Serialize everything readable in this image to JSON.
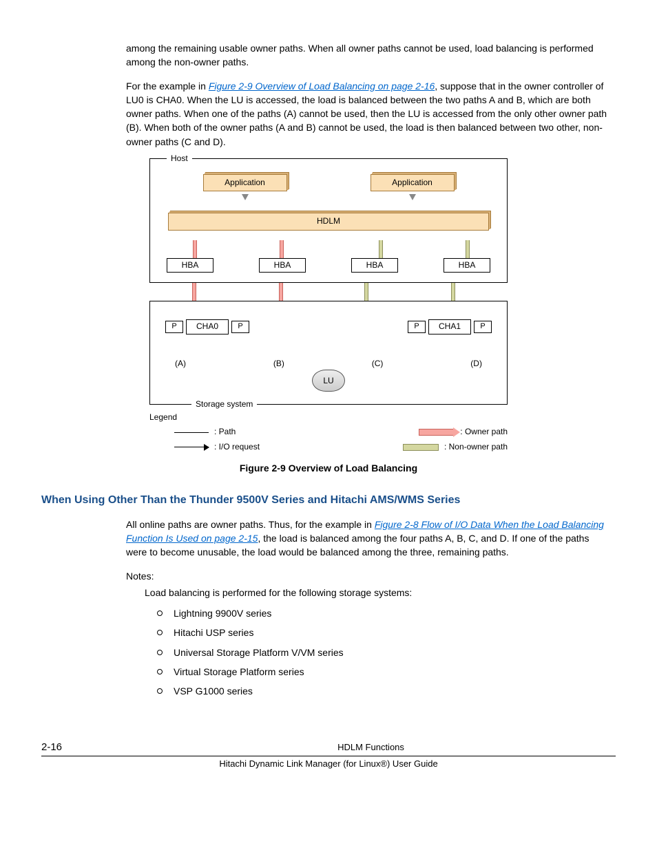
{
  "para1": "among the remaining usable owner paths. When all owner paths cannot be used, load balancing is performed among the non-owner paths.",
  "para2_a": "For the example in ",
  "para2_link": "Figure 2-9 Overview of Load Balancing on page 2-16",
  "para2_b": ", suppose that in the owner controller of LU0 is CHA0. When the LU is accessed, the load is balanced between the two paths A and B, which are both owner paths. When one of the paths (A) cannot be used, then the LU is accessed from the only other owner path (B). When both of the owner paths (A and B) cannot be used, the load is then balanced between two other, non-owner paths (C and D).",
  "diagram": {
    "host_label": "Host",
    "application": "Application",
    "hdlm": "HDLM",
    "hba": "HBA",
    "storage_label": "Storage system",
    "p": "P",
    "cha0": "CHA0",
    "cha1": "CHA1",
    "path_a": "(A)",
    "path_b": "(B)",
    "path_c": "(C)",
    "path_d": "(D)",
    "lu": "LU",
    "legend_title": "Legend",
    "legend_path": ": Path",
    "legend_io": ": I/O request",
    "legend_owner": ": Owner path",
    "legend_nonowner": ": Non-owner path"
  },
  "figure_caption": "Figure 2-9 Overview of Load Balancing",
  "section_heading": "When Using Other Than the Thunder 9500V Series and Hitachi AMS/WMS Series",
  "sec_para_a": "All online paths are owner paths. Thus, for the example in ",
  "sec_link": "Figure 2-8 Flow of I/O Data When the Load Balancing Function Is Used on page 2-15",
  "sec_para_b": ", the load is balanced among the four paths A, B, C, and D. If one of the paths were to become unusable, the load would be balanced among the three, remaining paths.",
  "notes_label": "Notes:",
  "notes_intro": "Load balancing is performed for the following storage systems:",
  "bullets": [
    "Lightning 9900V series",
    "Hitachi USP series",
    "Universal Storage Platform V/VM series",
    "Virtual Storage Platform series",
    "VSP G1000 series"
  ],
  "footer": {
    "page": "2-16",
    "title": "HDLM Functions",
    "subtitle": "Hitachi Dynamic Link Manager (for Linux®) User Guide"
  }
}
